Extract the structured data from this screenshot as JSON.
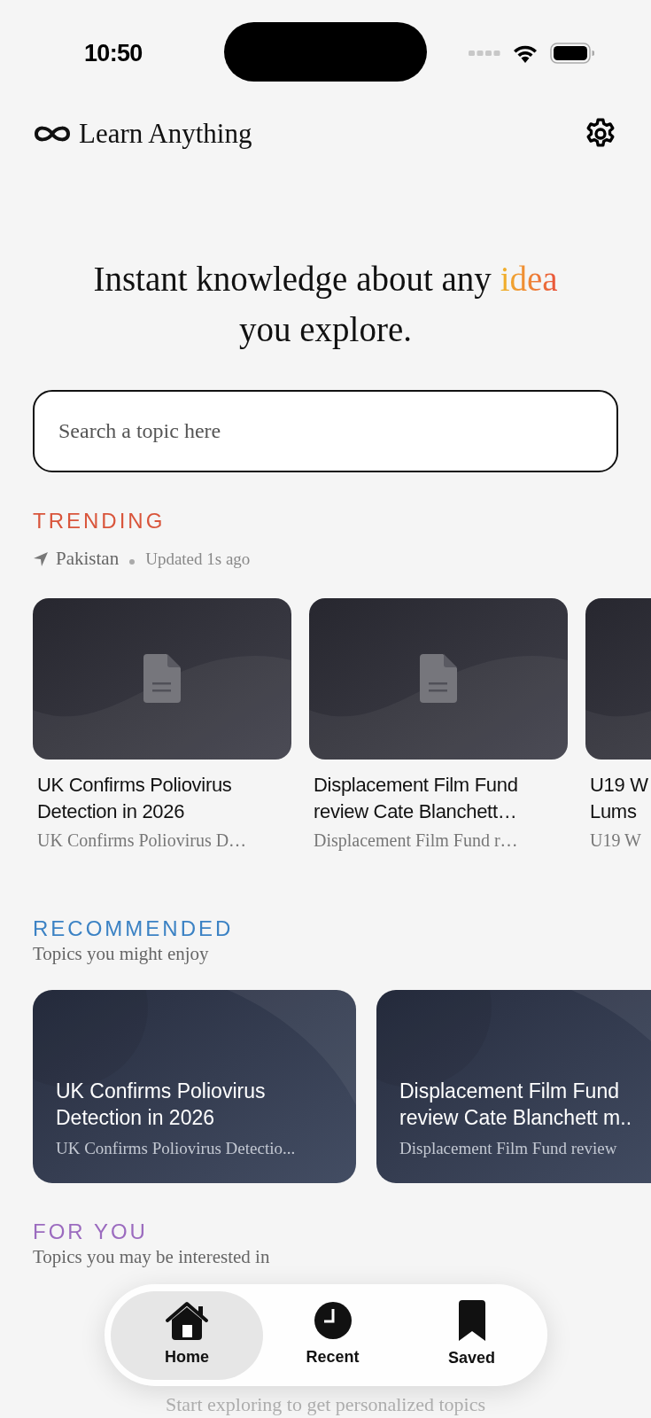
{
  "status_bar": {
    "time": "10:50"
  },
  "header": {
    "title": "Learn Anything"
  },
  "hero": {
    "before": "Instant knowledge about any",
    "highlight": "idea",
    "after": "you explore."
  },
  "search": {
    "placeholder": "Search a topic here"
  },
  "trending": {
    "heading": "TRENDING",
    "location": "Pakistan",
    "updated": "Updated 1s ago",
    "cards": [
      {
        "title": "UK Confirms Poliovirus\nDetection in 2026",
        "subtitle": "UK Confirms Poliovirus D…"
      },
      {
        "title": "Displacement Film Fund\nreview Cate Blanchett…",
        "subtitle": "Displacement Film Fund r…"
      },
      {
        "title": "U19 W\nLums",
        "subtitle": "U19 W"
      }
    ]
  },
  "recommended": {
    "heading": "RECOMMENDED",
    "subtitle": "Topics you might enjoy",
    "cards": [
      {
        "title": "UK Confirms Poliovirus\nDetection in 2026",
        "subtitle": "UK Confirms Poliovirus Detectio..."
      },
      {
        "title": "Displacement Film Fund\nreview Cate Blanchett m..",
        "subtitle": "Displacement Film Fund review"
      }
    ]
  },
  "for_you": {
    "heading": "FOR YOU",
    "subtitle": "Topics you may be interested in",
    "empty_text": "Start exploring to get personalized topics"
  },
  "tab_bar": {
    "tabs": [
      {
        "kind": "home",
        "label": "Home",
        "selected": true
      },
      {
        "kind": "recent",
        "label": "Recent",
        "selected": false
      },
      {
        "kind": "saved",
        "label": "Saved",
        "selected": false
      }
    ]
  }
}
